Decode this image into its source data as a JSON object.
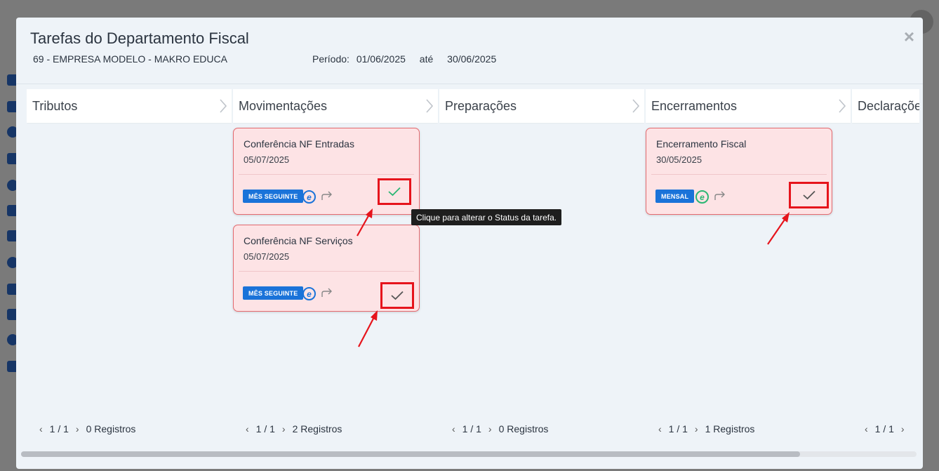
{
  "modal": {
    "title": "Tarefas do Departamento Fiscal",
    "company": "69 - EMPRESA MODELO - MAKRO EDUCA",
    "period_label": "Período:",
    "period_start": "01/06/2025",
    "period_sep": "até",
    "period_end": "30/06/2025",
    "close_icon": "×"
  },
  "columns": [
    {
      "title": "Tributos",
      "page": "1 / 1",
      "registros": "0 Registros"
    },
    {
      "title": "Movimentações",
      "page": "1 / 1",
      "registros": "2 Registros"
    },
    {
      "title": "Preparações",
      "page": "1 / 1",
      "registros": "0 Registros"
    },
    {
      "title": "Encerramentos",
      "page": "1 / 1",
      "registros": "1 Registros"
    },
    {
      "title": "Declarações",
      "page": "1 / 1",
      "registros": ""
    }
  ],
  "cards": [
    {
      "title": "Conferência NF Entradas",
      "date": "05/07/2025",
      "badge": "MÊS SEGUINTE",
      "e_color": "#1a73d9",
      "check_color": "#2bb673"
    },
    {
      "title": "Conferência NF Serviços",
      "date": "05/07/2025",
      "badge": "MÊS SEGUINTE",
      "e_color": "#1a73d9",
      "check_color": "#555555"
    },
    {
      "title": "Encerramento Fiscal",
      "date": "30/05/2025",
      "badge": "MENSAL",
      "e_color": "#2bb673",
      "check_color": "#555555"
    }
  ],
  "tooltip": "Clique para alterar o Status da tarefa.",
  "colors": {
    "accent": "#1a73d9",
    "card_bg": "#fde3e5",
    "card_border": "#e46a6f",
    "highlight": "#e6141c"
  }
}
